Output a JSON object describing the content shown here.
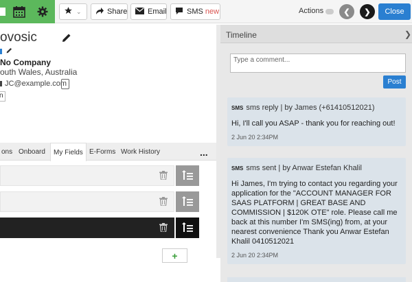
{
  "toolbar": {
    "star_label": "",
    "share_label": "Share",
    "email_label": "Email",
    "sms_label": "SMS",
    "sms_new_badge": "new",
    "actions_label": "Actions",
    "close_label": "Close"
  },
  "colors": {
    "accent_green": "#5cb85c",
    "primary_blue": "#2a7fd1",
    "sms_new_red": "#d9534f",
    "timeline_card": "#dbe3ea"
  },
  "profile": {
    "name": "ovosic",
    "company": "No Company",
    "location": "outh Wales, Australia",
    "email": "JC@example.com",
    "language": "n"
  },
  "tabs": [
    {
      "label": "ons"
    },
    {
      "label": "Onboard"
    },
    {
      "label": "My Fields"
    },
    {
      "label": "E-Forms"
    },
    {
      "label": "Work History"
    }
  ],
  "tabs_more": "...",
  "add_field_label": "+",
  "timeline": {
    "title": "Timeline",
    "comment_placeholder": "Type a comment...",
    "post_label": "Post",
    "entries": [
      {
        "badge": "SMS",
        "heading": "sms reply | by James (+61410512021)",
        "body": "Hi, I'll call you ASAP - thank you for reaching out!",
        "date": "2 Jun 20 2:34PM"
      },
      {
        "badge": "SMS",
        "heading": "sms sent | by Anwar Estefan Khalil",
        "body": "Hi James, I'm trying to contact you regarding your application for the \"ACCOUNT MANAGER FOR SAAS PLATFORM | GREAT BASE AND COMMISSION | $120K OTE\" role. Please call me back at this number I'm SMS(ing) from, at your nearest convenience Thank you Anwar Estefan Khalil 0410512021",
        "date": "2 Jun 20 2:34PM"
      }
    ]
  }
}
